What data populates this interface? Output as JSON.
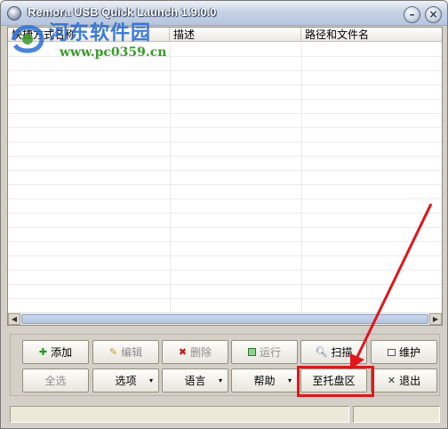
{
  "window": {
    "title": "Remora USB Quick Launch 1.9.0.0",
    "min_glyph": "–",
    "close_glyph": "×"
  },
  "watermark": {
    "name": "河东软件园",
    "url": "www.pc0359.cn"
  },
  "list": {
    "columns": [
      "快捷方式名称",
      "描述",
      "路径和文件名"
    ],
    "rows": []
  },
  "buttons": {
    "add": "添加",
    "edit": "编辑",
    "delete": "删除",
    "run": "运行",
    "scan": "扫描",
    "maintain": "维护",
    "select_all": "全选",
    "options": "选项",
    "language": "语言",
    "help": "帮助",
    "to_tray": "至托盘区",
    "exit": "退出"
  },
  "icons": {
    "add": "plus-icon",
    "edit": "pencil-icon",
    "delete": "x-icon",
    "run": "run-icon",
    "scan": "magnifier-icon",
    "maintain": "window-icon",
    "exit": "close-icon",
    "dropdown": "triangle-down-icon"
  },
  "glyphs": {
    "add": "✚",
    "edit": "✎",
    "delete": "✖",
    "scan": "🔍︎",
    "exit": "✕",
    "dropdown": "▾",
    "left": "◀",
    "right": "▶"
  },
  "status": {
    "left": "",
    "right": ""
  },
  "colors": {
    "highlight": "#e0161c",
    "titlebar": "#c7d3e6",
    "watermark_name": "#2a6fd6",
    "watermark_url": "#3a9a2a"
  }
}
